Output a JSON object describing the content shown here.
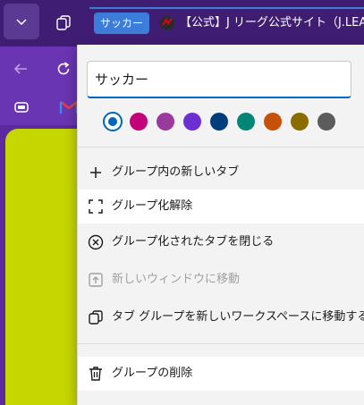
{
  "tabbar": {
    "group_chip_label": "サッカー",
    "tab_title": "【公式】J リーグ公式サイト（J.LEA"
  },
  "context_menu": {
    "group_name_value": "サッカー",
    "colors": [
      {
        "name": "blue",
        "hex": "#0067c0",
        "selected": true
      },
      {
        "name": "pink",
        "hex": "#c3007a",
        "selected": false
      },
      {
        "name": "purple",
        "hex": "#9b3a9e",
        "selected": false
      },
      {
        "name": "violet",
        "hex": "#6b2fd2",
        "selected": false
      },
      {
        "name": "navy",
        "hex": "#003d7c",
        "selected": false
      },
      {
        "name": "teal",
        "hex": "#008577",
        "selected": false
      },
      {
        "name": "orange",
        "hex": "#c7500b",
        "selected": false
      },
      {
        "name": "olive",
        "hex": "#8a6d00",
        "selected": false
      },
      {
        "name": "gray",
        "hex": "#5c5c5c",
        "selected": false
      }
    ],
    "items": {
      "new_tab": {
        "label": "グループ内の新しいタブ",
        "icon": "plus-icon"
      },
      "ungroup": {
        "label": "グループ化解除",
        "icon": "ungroup-icon"
      },
      "close_group": {
        "label": "グループ化されたタブを閉じる",
        "icon": "close-circle-icon"
      },
      "move_window": {
        "label": "新しいウィンドウに移動",
        "icon": "move-window-icon",
        "disabled": true
      },
      "move_workspace": {
        "label": "タブ グループを新しいワークスペースに移動する",
        "icon": "workspaces-icon"
      },
      "delete_group": {
        "label": "グループの削除",
        "icon": "trash-icon"
      }
    }
  }
}
